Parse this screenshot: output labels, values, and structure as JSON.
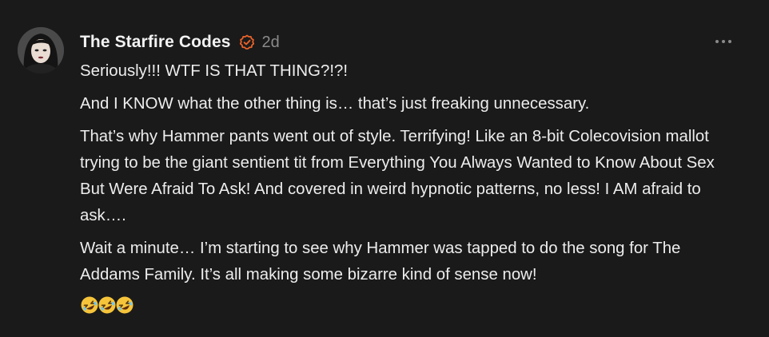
{
  "comment": {
    "author": "The Starfire Codes",
    "timestamp": "2d",
    "verified_icon": "verified-check-icon",
    "more_icon": "more-horizontal-icon",
    "paragraphs": [
      "Seriously!!! WTF IS THAT THING?!?!",
      "And I KNOW what the other thing is… that’s just freaking unnecessary.",
      "That’s why Hammer pants went out of style. Terrifying! Like an 8-bit Colecovision mallot trying to be the giant sentient tit from Everything You Always Wanted to Know About Sex But Were Afraid To Ask! And covered in weird hypnotic patterns, no less! I AM afraid to ask….",
      "Wait a minute… I’m starting to see why Hammer was tapped to do the song for The Addams Family. It’s all making some bizarre kind of sense now!"
    ],
    "emoji": [
      "rolling-on-floor-laughing",
      "rolling-on-floor-laughing",
      "rolling-on-floor-laughing"
    ]
  },
  "colors": {
    "background": "#1a1a1a",
    "text": "#ededed",
    "muted": "#8a8a8a",
    "accent": "#e8622a"
  }
}
